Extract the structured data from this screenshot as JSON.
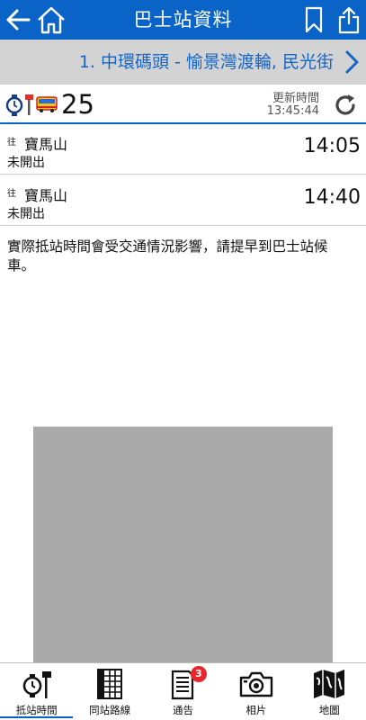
{
  "header": {
    "title": "巴士站資料",
    "icons": {
      "back": "arrow-left-icon",
      "home": "home-icon",
      "bookmark": "bookmark-icon",
      "share": "share-icon"
    }
  },
  "route_bar": {
    "stop_text": "1. 中環碼頭 - 愉景灣渡輪, 民光街",
    "next_icon": "chevron-right-icon"
  },
  "bus_info": {
    "route_number": "25",
    "update_label": "更新時間",
    "update_time": "13:45:44",
    "icons": {
      "stop": "bus-stop-icon",
      "bus": "bus-icon",
      "refresh": "refresh-icon"
    }
  },
  "eta_rows": [
    {
      "direction_label": "往",
      "destination": "寶馬山",
      "status": "未開出",
      "time": "14:05"
    },
    {
      "direction_label": "往",
      "destination": "寶馬山",
      "status": "未開出",
      "time": "14:40"
    }
  ],
  "notice": "實際抵站時間會受交通情況影響，請提早到巴士站候車。",
  "tabs": [
    {
      "label": "抵站時間",
      "icon": "bus-stop-clock-icon",
      "active": true
    },
    {
      "label": "同站路線",
      "icon": "timetable-icon",
      "active": false
    },
    {
      "label": "通告",
      "icon": "notice-icon",
      "active": false,
      "badge": "3"
    },
    {
      "label": "相片",
      "icon": "camera-icon",
      "active": false
    },
    {
      "label": "地圖",
      "icon": "map-icon",
      "active": false
    }
  ],
  "colors": {
    "header_bg": "#0a63c6",
    "route_text": "#1565c8",
    "route_bar_bg": "#d3d3d3",
    "badge": "#e8262f",
    "ad_placeholder": "#aaaaaa"
  }
}
